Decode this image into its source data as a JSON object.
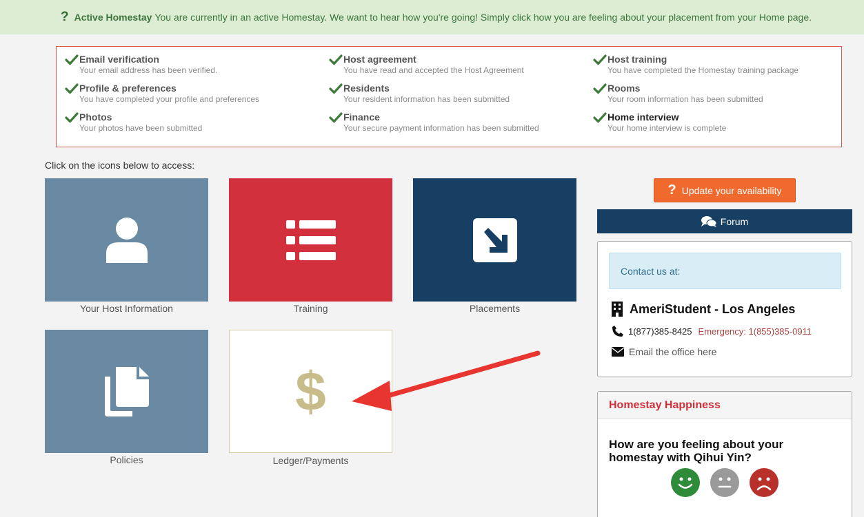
{
  "banner": {
    "title": "Active Homestay",
    "message": "You are currently in an active Homestay. We want to hear how you're going! Simply click how you are feeling about your placement from your Home page."
  },
  "checklist": [
    {
      "title": "Email verification",
      "desc": "Your email address has been verified."
    },
    {
      "title": "Host agreement",
      "desc": "You have read and accepted the Host Agreement"
    },
    {
      "title": "Host training",
      "desc": "You have completed the Homestay training package"
    },
    {
      "title": "Profile & preferences",
      "desc": "You have completed your profile and preferences"
    },
    {
      "title": "Residents",
      "desc": "Your resident information has been submitted"
    },
    {
      "title": "Rooms",
      "desc": "Your room information has been submitted"
    },
    {
      "title": "Photos",
      "desc": "Your photos have been submitted"
    },
    {
      "title": "Finance",
      "desc": "Your secure payment information has been submitted"
    },
    {
      "title": "Home interview",
      "desc": "Your home interview is complete"
    }
  ],
  "access_prompt": "Click on the icons below to access:",
  "tiles": {
    "host": "Your Host Information",
    "training": "Training",
    "placements": "Placements",
    "policies": "Policies",
    "ledger": "Ledger/Payments"
  },
  "sidebar": {
    "availability_button": "Update your availability",
    "forum_button": "Forum",
    "contact": {
      "header": "Contact us at:",
      "office": "AmeriStudent - Los Angeles",
      "phone": "1(877)385-8425",
      "emergency": "Emergency: 1(855)385-0911",
      "email_link": "Email the office here"
    },
    "happiness": {
      "title": "Homestay Happiness",
      "question": "How are you feeling about your homestay with Qihui Yin?"
    }
  },
  "colors": {
    "success_green": "#3c763d",
    "tick_green": "#3e7a3a",
    "alert_red": "#d9534f",
    "tile_slate": "#6a8aa3",
    "tile_red": "#d2303c",
    "tile_navy": "#173f63",
    "ledger_gold": "#c8bd8a",
    "orange": "#f06a2e",
    "face_happy": "#2e8b3a",
    "face_neutral": "#9a9a9a",
    "face_sad": "#b8302a",
    "arrow_red": "#e8352f"
  },
  "icons": {
    "banner": "question-icon",
    "check": "check-icon",
    "host": "user-icon",
    "training": "list-icon",
    "placements": "arrow-down-right-square-icon",
    "policies": "documents-icon",
    "ledger": "dollar-icon",
    "forum": "comments-icon",
    "office": "building-icon",
    "phone": "phone-icon",
    "email": "envelope-icon",
    "moods": [
      "smile-face-icon",
      "neutral-face-icon",
      "sad-face-icon"
    ]
  }
}
